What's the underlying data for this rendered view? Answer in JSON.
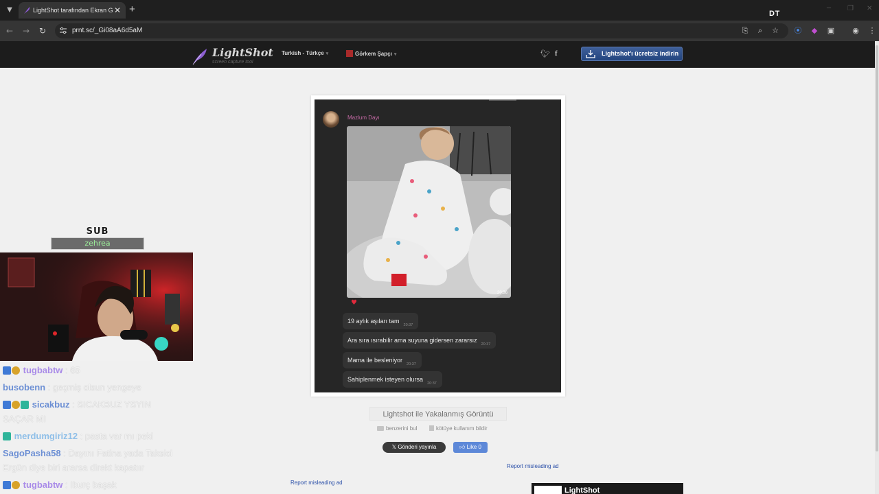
{
  "browser": {
    "tab_title": "LightShot tarafından Ekran Görüntüsü",
    "url": "prnt.sc/_Gi08aA6d5aM",
    "overlay_logo": "DT",
    "icons": [
      "chevron-down-icon",
      "close-icon",
      "plus-icon",
      "back-icon",
      "forward-icon",
      "reload-icon",
      "site-info-icon",
      "install-icon",
      "zoom-icon",
      "star-icon",
      "extension-icon",
      "profile-icon",
      "menu-icon"
    ]
  },
  "site": {
    "logo": "LightShot",
    "logo_sub": "screen capture tool",
    "language": "Turkish - Türkçe",
    "user": "Görkem Şapçı",
    "download_label": "Lightshot'ı ücretsiz indirin"
  },
  "screenshot": {
    "sender": "Mazlum Dayı",
    "photo_time": "20:36",
    "messages": [
      {
        "text": "19 aylık aşıları tam",
        "time": "20:37"
      },
      {
        "text": "Ara sıra ısırabilir ama suyuna gidersen zararsız",
        "time": "20:37"
      },
      {
        "text": "Mama ile besleniyor",
        "time": "20:37"
      },
      {
        "text": "Sahiplenmek isteyen olursa",
        "time": "20:37"
      }
    ]
  },
  "page": {
    "caption": "Lightshot ile Yakalanmış Görüntü",
    "similar": "benzerini bul",
    "report": "kötüye kullanım bildir",
    "tweet": "Gönderi yayınla",
    "like": "Like 0",
    "ad_report_1": "Report misleading ad",
    "ad_report_2": "Report misleading ad",
    "ad_text": "LightShot"
  },
  "stream": {
    "sub_title": "SUB",
    "sub_name": "zehrea",
    "chat": [
      {
        "user": "tugbabtw",
        "text": ": 65",
        "color": "#a98be8"
      },
      {
        "user": "busobenn",
        "text": ": geçmiş olsun yengeye",
        "color": "#6c8fd4"
      },
      {
        "user": "sicakbuz",
        "text": ": SICAKBUZ YSYIN",
        "color": "#6c8fd4"
      },
      {
        "user": "",
        "text": "SAÇAR MI",
        "color": "#6c8fd4"
      },
      {
        "user": "merdumgiriz12",
        "text": ": pasta var mı peki",
        "color": "#8fbfe8"
      },
      {
        "user": "SagoPasha58",
        "text": ": Dayını Fatina yada Taksici",
        "color": "#6c8fd4"
      },
      {
        "user": "",
        "text": "Ergün diye biri ararsa direkt kapatıır",
        "color": "#6c8fd4"
      },
      {
        "user": "tugbabtw",
        "text": ": Iburç başak",
        "color": "#a98be8"
      }
    ]
  },
  "colors": {
    "accent": "#3f5f99",
    "sender": "#c56aa5",
    "link": "#2a4fa8"
  }
}
